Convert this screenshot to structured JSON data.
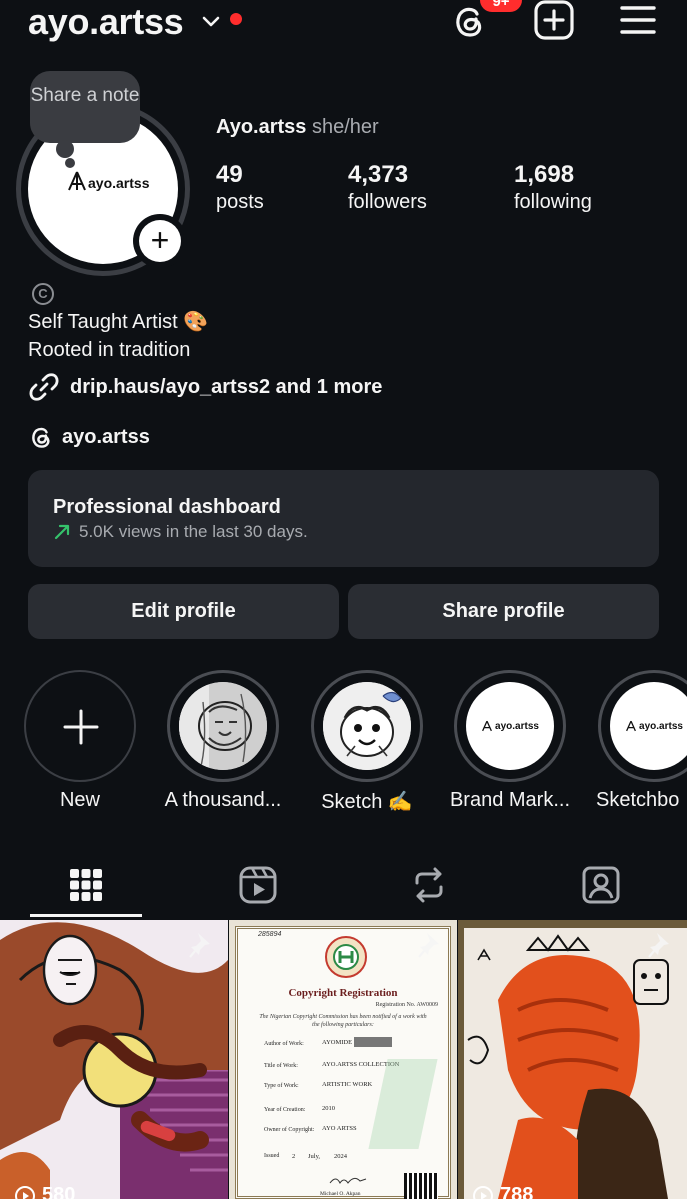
{
  "header": {
    "username": "ayo.artss",
    "threads_badge": "9+",
    "icons": [
      "chevron-down-icon",
      "threads-icon",
      "add-post-icon",
      "menu-icon"
    ]
  },
  "note": {
    "text": "Share a note"
  },
  "profile": {
    "avatar_logo_text": "ayo.artss",
    "display_name": "Ayo.artss",
    "pronouns": "she/her"
  },
  "stats": [
    {
      "value": "49",
      "label": "posts"
    },
    {
      "value": "4,373",
      "label": "followers"
    },
    {
      "value": "1,698",
      "label": "following"
    }
  ],
  "bio": {
    "line1": "Self Taught Artist 🎨",
    "line2": "Rooted in tradition",
    "link": "drip.haus/ayo_artss2 and 1 more",
    "threads_handle": "ayo.artss"
  },
  "dashboard": {
    "title": "Professional dashboard",
    "subtitle": "5.0K views in the last 30 days."
  },
  "buttons": {
    "edit": "Edit profile",
    "share": "Share profile"
  },
  "highlights": [
    {
      "label": "New"
    },
    {
      "label": "A thousand..."
    },
    {
      "label": "Sketch ✍️"
    },
    {
      "label": "Brand Mark..."
    },
    {
      "label": "Sketchbo",
      "logo_text": "ayo.artss"
    }
  ],
  "highlight_logo_text": "ayo.artss",
  "tabs": [
    "grid-icon",
    "reels-icon",
    "reposts-icon",
    "tagged-icon"
  ],
  "posts": [
    {
      "views": "580"
    },
    {
      "doc_title": "Copyright Registration",
      "doc_reg": "Registration No. AW0009",
      "doc_intro": "The Nigerian Copyright Commission has been notified of a work with the following particulars:",
      "serial": "285894",
      "rows": [
        {
          "k": "Author of Work:",
          "v": "AYOMIDE"
        },
        {
          "k": "Title of Work:",
          "v": "AYO.ARTSS COLLECTION"
        },
        {
          "k": "Type of Work:",
          "v": "ARTISTIC WORK"
        },
        {
          "k": "Year of Creation:",
          "v": "2010"
        },
        {
          "k": "Owner of Copyright:",
          "v": "AYO ARTSS"
        }
      ],
      "issued_label": "Issued",
      "issued_day": "2",
      "issued_month": "July,",
      "issued_year": "2024",
      "signer": "Michael O. Akpan"
    },
    {
      "views": "788"
    }
  ]
}
